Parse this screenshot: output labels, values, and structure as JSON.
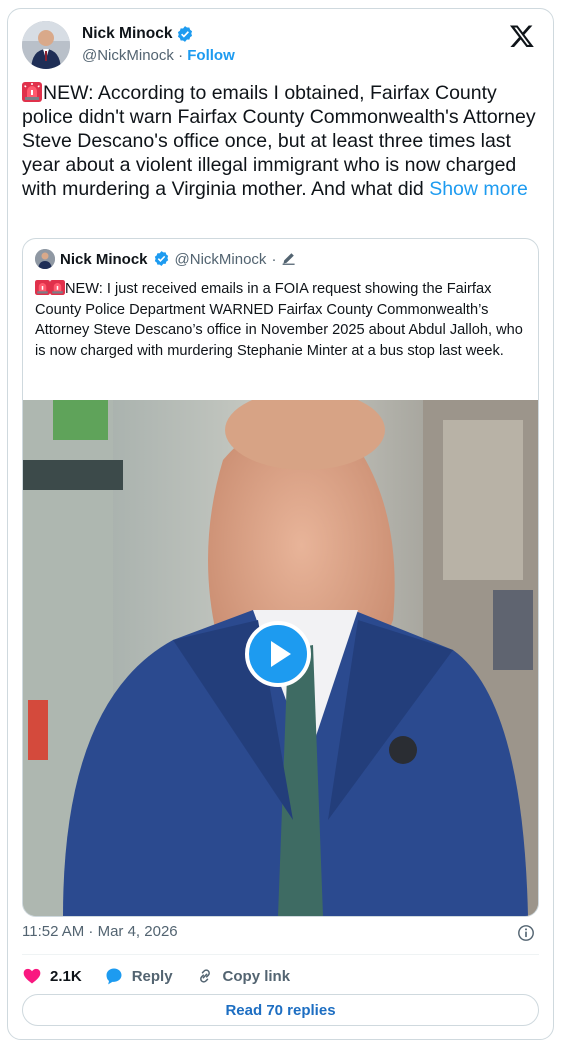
{
  "author": {
    "name": "Nick Minock",
    "handle": "@NickMinock",
    "separator": " · ",
    "follow_label": "Follow"
  },
  "tweet": {
    "text": "NEW: According to emails I obtained, Fairfax County police didn't warn Fairfax County Commonwealth's Attorney Steve Descano's office once, but at least three times last year about a violent illegal immigrant who is now charged with murdering a Virginia mother.  And what did ",
    "show_more_label": "Show more"
  },
  "quoted": {
    "name": "Nick Minock",
    "handle": "@NickMinock",
    "dot": "·",
    "text": "NEW: I just received emails in a FOIA request showing the Fairfax County Police Department WARNED Fairfax County Commonwealth’s Attorney Steve Descano’s office in November 2025 about Abdul Jalloh, who is now charged with murdering Stephanie Minter at a bus stop last week."
  },
  "timestamp": "11:52 AM · Mar 4, 2026",
  "actions": {
    "likes": "2.1K",
    "reply_label": "Reply",
    "copy_link_label": "Copy link"
  },
  "read_replies_label": "Read 70 replies",
  "colors": {
    "accent": "#1d9bf0",
    "like": "#f91880",
    "text": "#0f1419",
    "muted": "#536471"
  },
  "icons": [
    "verified-badge-icon",
    "x-logo-icon",
    "siren-icon",
    "edit-pencil-icon",
    "play-icon",
    "info-icon",
    "heart-icon",
    "reply-bubble-icon",
    "link-icon"
  ]
}
